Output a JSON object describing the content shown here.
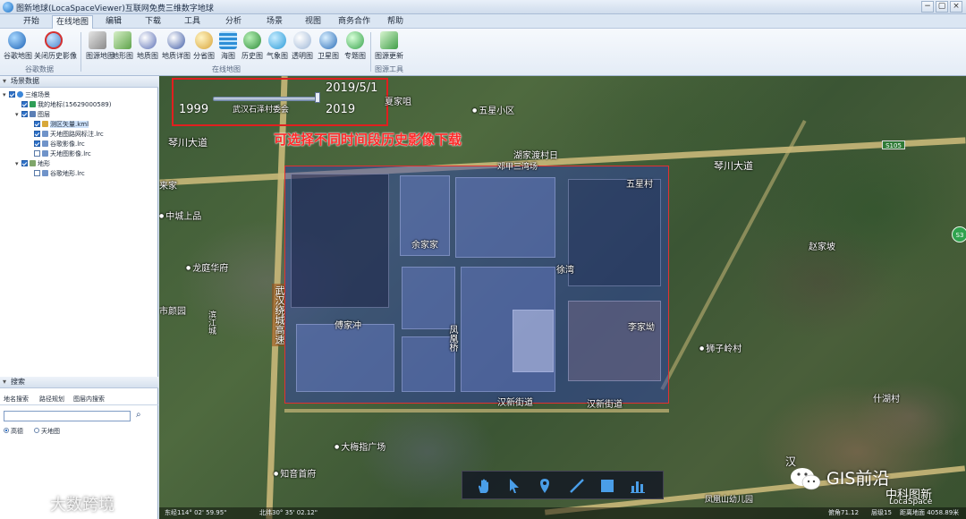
{
  "window": {
    "title": "图新地球(LocaSpaceViewer)互联网免费三维数字地球",
    "controls": [
      "−",
      "▢",
      "×"
    ]
  },
  "menu": [
    "开始",
    "在线地图",
    "编辑",
    "下载",
    "工具",
    "分析",
    "场景",
    "视图",
    "商务合作",
    "帮助"
  ],
  "ribbon": {
    "groups": [
      {
        "label": "谷歌数据",
        "buttons": [
          "谷歌地图",
          "关闭历史影像"
        ]
      },
      {
        "label": "在线地图",
        "buttons": [
          "图源地图",
          "地形图",
          "地质图",
          "地质详图",
          "分省图",
          "海图",
          "历史图",
          "气象图",
          "透明图",
          "卫星图",
          "专题图"
        ]
      },
      {
        "label": "图源工具",
        "buttons": [
          "图源更新"
        ]
      }
    ]
  },
  "left_panel": {
    "scene_header": "场景数据",
    "tree": [
      {
        "level": 0,
        "twisty": "▾",
        "checked": true,
        "label": "三维场景"
      },
      {
        "level": 1,
        "twisty": "",
        "checked": true,
        "label": "我的地标(15629000589)"
      },
      {
        "level": 1,
        "twisty": "▾",
        "checked": true,
        "label": "图层"
      },
      {
        "level": 2,
        "twisty": "",
        "checked": true,
        "label": "测区矢量.kml",
        "selected": true
      },
      {
        "level": 2,
        "twisty": "",
        "checked": true,
        "label": "天地图路网标注.lrc"
      },
      {
        "level": 2,
        "twisty": "",
        "checked": true,
        "label": "谷歌影像.lrc"
      },
      {
        "level": 2,
        "twisty": "",
        "checked": false,
        "label": "天地图影像.lrc"
      },
      {
        "level": 1,
        "twisty": "▾",
        "checked": true,
        "label": "地形"
      },
      {
        "level": 2,
        "twisty": "",
        "checked": false,
        "label": "谷歌地形.lrc"
      }
    ],
    "search_header": "搜索",
    "search_tabs": [
      "地名搜索",
      "路径规划",
      "图层内搜索"
    ],
    "search_placeholder": "",
    "search_icon": "magnifier-icon",
    "sources": [
      {
        "label": "高德",
        "selected": true
      },
      {
        "label": "天地图",
        "selected": false
      }
    ]
  },
  "map": {
    "timeline": {
      "start": "1999",
      "end": "2019",
      "current": "2019/5/1",
      "current_fraction": 1.0
    },
    "caption": "可选择不同时间段历史影像下载",
    "places": [
      "夏家咀",
      "五星小区",
      "湖家渡村日",
      "邓甲三湾场",
      "五星村",
      "余家家",
      "徐湾",
      "傅家冲",
      "凤凰桥",
      "汉新街道",
      "汉新街道",
      "李家坳",
      "狮子岭村",
      "赵家坡",
      "什湖村",
      "龙庭华府",
      "中城上品",
      "来家",
      "市颜园",
      "大梅指广场",
      "知音首府",
      "凤凰山幼儿园",
      "滨江城",
      "琴川大道",
      "琴川大道",
      "武汉石泽村委会",
      "汉"
    ],
    "highway_label": "武汉绕城高速",
    "road_shield": "S105",
    "compass": "S3",
    "tools": [
      "hand-icon",
      "pointer-icon",
      "marker-icon",
      "line-icon",
      "polygon-icon",
      "chart-icon"
    ],
    "status": {
      "lon": "东经114° 02' 59.95\"",
      "lat": "北纬30° 35' 02.12\"",
      "tilt": "俯角71.12",
      "level": "层级15",
      "altitude": "距离地面 4058.89米"
    },
    "brand": {
      "main": "GIS前沿",
      "sub": "中科图新",
      "en": "LocaSpace"
    }
  },
  "watermark": "大数跨境",
  "colors": {
    "accent": "#2f72c9",
    "aoi_border": "#e23131",
    "caption": "#ff2a2a"
  }
}
